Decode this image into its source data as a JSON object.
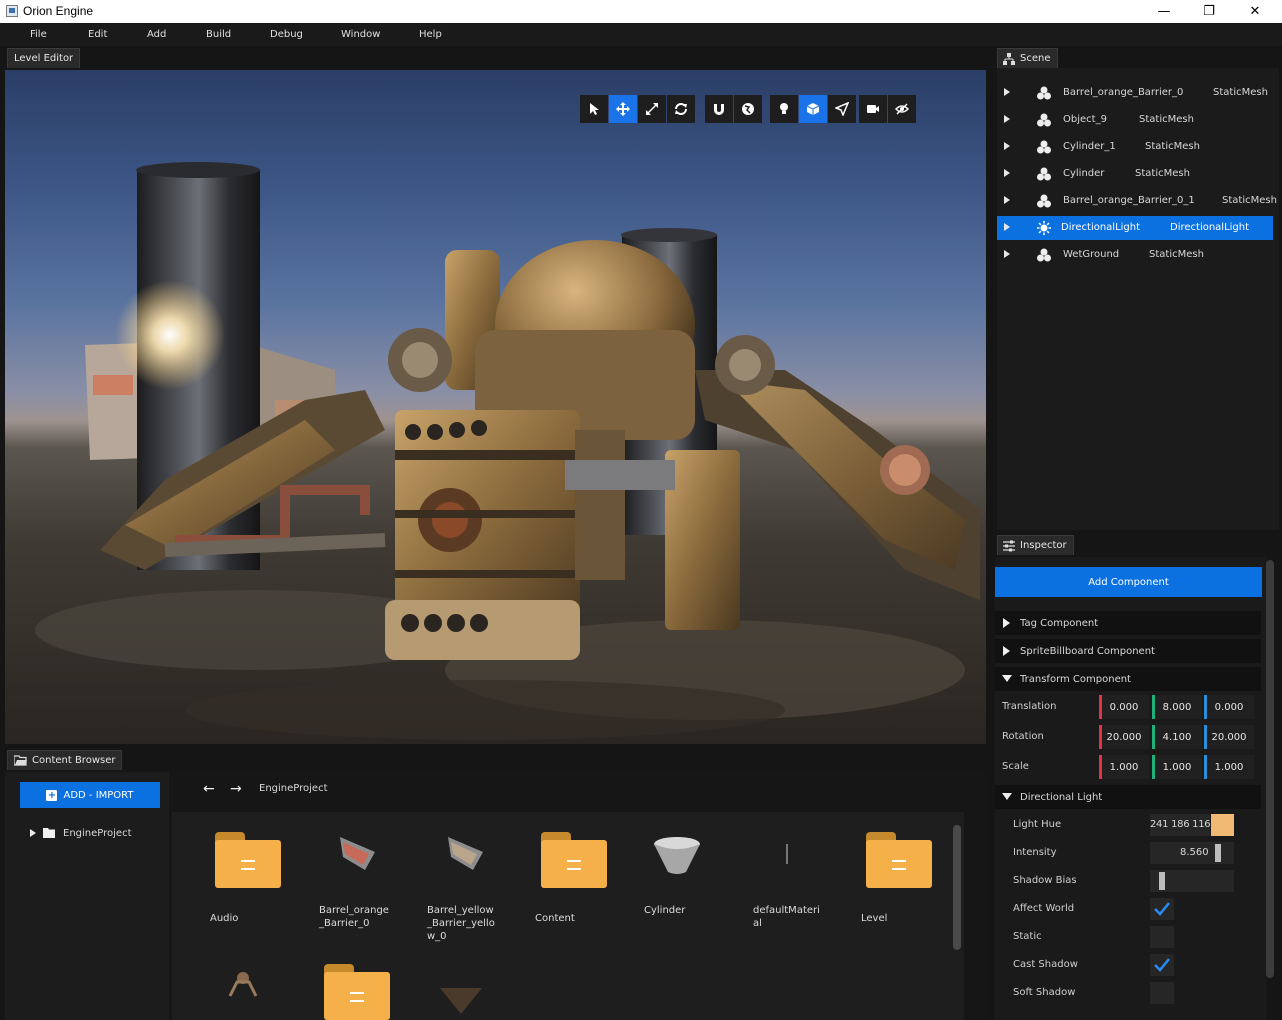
{
  "window": {
    "title": "Orion Engine",
    "minimize": "—",
    "maximize": "❐",
    "close": "✕"
  },
  "menu": [
    "File",
    "Edit",
    "Add",
    "Build",
    "Debug",
    "Window",
    "Help"
  ],
  "viewport": {
    "tab": "Level Editor",
    "toolbar": [
      "select",
      "move",
      "scale",
      "rotate",
      "snap",
      "gizmo-mode",
      "light",
      "cube",
      "nav",
      "camera",
      "hide"
    ]
  },
  "scene": {
    "tab": "Scene",
    "items": [
      {
        "name": "Barrel_orange_Barrier_0",
        "type": "StaticMesh"
      },
      {
        "name": "Object_9",
        "type": "StaticMesh"
      },
      {
        "name": "Cylinder_1",
        "type": "StaticMesh"
      },
      {
        "name": "Cylinder",
        "type": "StaticMesh"
      },
      {
        "name": "Barrel_orange_Barrier_0_1",
        "type": "StaticMesh"
      },
      {
        "name": "DirectionalLight",
        "type": "DirectionalLight"
      },
      {
        "name": "WetGround",
        "type": "StaticMesh"
      }
    ],
    "selected": "DirectionalLight"
  },
  "inspector": {
    "tab": "Inspector",
    "add_component": "Add Component",
    "sections": [
      "Tag Component",
      "SpriteBillboard Component",
      "Transform Component"
    ],
    "transform": {
      "labels": [
        "Translation",
        "Rotation",
        "Scale"
      ],
      "values": [
        [
          "0.000",
          "8.000",
          "0.000"
        ],
        [
          "20.000",
          "4.100",
          "20.000"
        ],
        [
          "1.000",
          "1.000",
          "1.000"
        ]
      ]
    },
    "light_section": "Directional Light",
    "light": {
      "hue_label": "Light Hue",
      "hue_values": "241 186 116",
      "hue_color": "#f1ba74",
      "intensity_label": "Intensity",
      "intensity_value": "8.560",
      "shadow_bias_label": "Shadow Bias",
      "affect_world_label": "Affect World",
      "affect_world": true,
      "static_label": "Static",
      "static": false,
      "cast_shadow_label": "Cast Shadow",
      "cast_shadow": true,
      "soft_shadow_label": "Soft Shadow",
      "soft_shadow": false
    }
  },
  "content": {
    "tab": "Content Browser",
    "import": "ADD - IMPORT",
    "path": "EngineProject",
    "tree_root": "EngineProject",
    "assets": [
      {
        "name": "Audio",
        "kind": "folder"
      },
      {
        "name": "Barrel_orange _Barrier_0",
        "kind": "mesh"
      },
      {
        "name": "Barrel_yellow _Barrier_yello w_0",
        "kind": "mesh"
      },
      {
        "name": "Content",
        "kind": "folder"
      },
      {
        "name": "Cylinder",
        "kind": "mesh"
      },
      {
        "name": "defaultMateri al",
        "kind": "material"
      },
      {
        "name": "Level",
        "kind": "folder"
      }
    ],
    "colors": {
      "accent": "#0b70e0",
      "folder": "#f6b04a",
      "x_axis": "#e0344a",
      "y_axis": "#1fb07a",
      "z_axis": "#2a8fd8"
    }
  }
}
